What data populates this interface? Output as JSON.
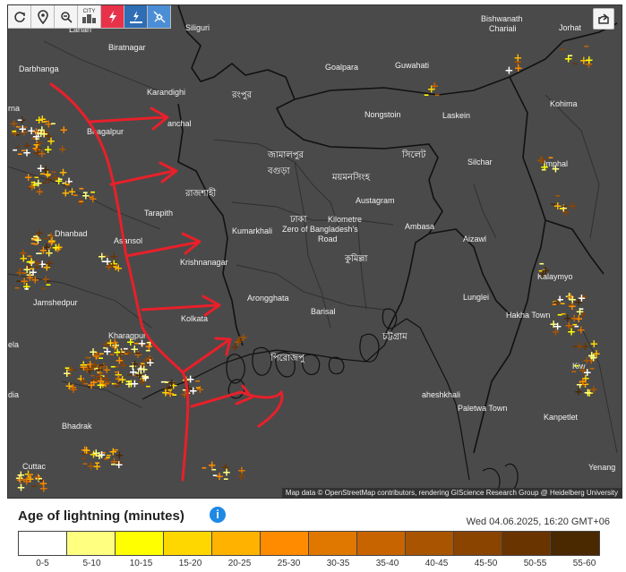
{
  "toolbar": {
    "buttons": [
      {
        "name": "refresh-button",
        "icon": "refresh-icon"
      },
      {
        "name": "locate-button",
        "icon": "location-pin-icon"
      },
      {
        "name": "zoom-button",
        "icon": "zoom-icon"
      },
      {
        "name": "city-button",
        "icon": "city-icon",
        "label": "CITY"
      },
      {
        "name": "lightning-button",
        "icon": "lightning-icon"
      },
      {
        "name": "strike-button",
        "icon": "strike-icon"
      },
      {
        "name": "satellite-button",
        "icon": "satellite-icon"
      }
    ]
  },
  "map": {
    "attribution": "Map data © OpenStreetMap contributors, rendering GIScience Research Group @ Heidelberg University",
    "cities": {
      "lahan": "Lahan",
      "biratnagar": "Biratnagar",
      "siliguri": "Siliguri",
      "bishwanath": "Bishwanath",
      "chariali": "Chariali",
      "jorhat": "Jorhat",
      "darbhanga": "Darbhanga",
      "goalpara": "Goalpara",
      "guwahati": "Guwahati",
      "karandighi": "Karandighi",
      "kohima": "Kohima",
      "nongstoin": "Nongstoin",
      "laskein": "Laskein",
      "bhagalpur": "Bhagalpur",
      "silchar": "Silchar",
      "imphal": "Imphal",
      "tarapith": "Tarapith",
      "austagram": "Austagram",
      "dhanbad": "Dhanbad",
      "asansol": "Asansol",
      "kumarkhali": "Kumarkhali",
      "zero_line1": "Kilometre",
      "zero_line2": "Zero of Bangladesh's",
      "zero_line3": "Road",
      "ambasa": "Ambasa",
      "aizawl": "Aizawl",
      "krishnanagar": "Krishnanagar",
      "kalaymyo": "Kalaymyo",
      "jamshedpur": "Jamshedpur",
      "arongghata": "Arongghata",
      "lunglei": "Lunglei",
      "barisal": "Barisal",
      "hakha_town": "Hakha Town",
      "kolkata": "Kolkata",
      "kharagpur": "Kharagpur",
      "bela": "ela",
      "dia": "dia",
      "maheshkhali": "aheshkhali",
      "paletwa": "Paletwa Town",
      "kanpetlet": "Kanpetlet",
      "bhadrak": "Bhadrak",
      "cuttack": "Cuttac",
      "yenang": "Yenang",
      "kiw": "Kiw",
      "rna": "rna",
      "anchal": "anchal"
    },
    "bengali": {
      "rangpur": "রংপুর",
      "jamalpur": "জামালপুর",
      "sylhet": "সিলেট",
      "bogura": "বগুড়া",
      "mymensingh": "ময়মনসিংহ",
      "rajshahi": "রাজশাহী",
      "dhaka": "ঢাকা",
      "cumilla": "কুমিল্লা",
      "chattogram": "চট্টগ্রাম",
      "pirojpur": "পিরোজপু"
    }
  },
  "legend": {
    "title": "Age of lightning (minutes)",
    "info_icon": "i",
    "timestamp": "Wed 04.06.2025, 16:20 GMT+06",
    "bins": [
      {
        "label": "0-5",
        "color": "#ffffff"
      },
      {
        "label": "5-10",
        "color": "#ffff80"
      },
      {
        "label": "10-15",
        "color": "#ffff00"
      },
      {
        "label": "15-20",
        "color": "#ffd700"
      },
      {
        "label": "20-25",
        "color": "#ffb300"
      },
      {
        "label": "25-30",
        "color": "#ff8c00"
      },
      {
        "label": "30-35",
        "color": "#e07800"
      },
      {
        "label": "35-40",
        "color": "#c86400"
      },
      {
        "label": "40-45",
        "color": "#a85400"
      },
      {
        "label": "45-50",
        "color": "#8a4400"
      },
      {
        "label": "50-55",
        "color": "#6a3400"
      },
      {
        "label": "55-60",
        "color": "#4a2800"
      }
    ]
  }
}
